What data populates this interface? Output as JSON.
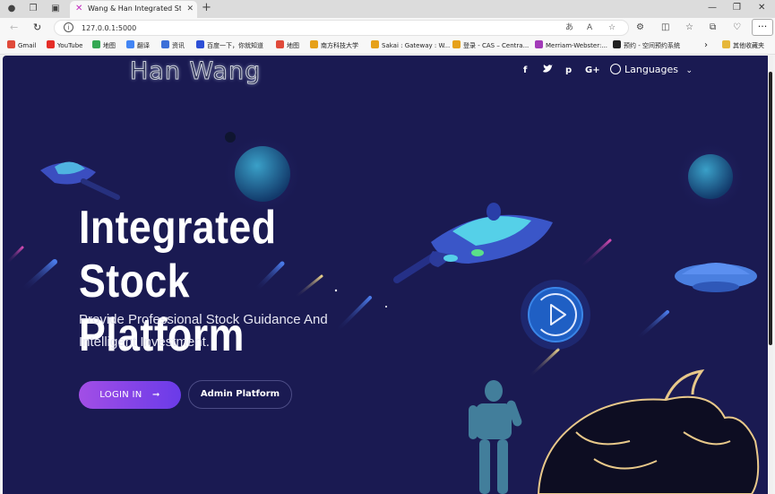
{
  "browser": {
    "tab_title": "Wang & Han Integrated Stock Pl",
    "url": "127.0.0.1:5000",
    "bookmarks": [
      {
        "label": "Gmail",
        "color": "#e04a3a"
      },
      {
        "label": "YouTube",
        "color": "#e52d27"
      },
      {
        "label": "地图",
        "color": "#34a853"
      },
      {
        "label": "翻译",
        "color": "#4285f4"
      },
      {
        "label": "资讯",
        "color": "#3b6fd8"
      },
      {
        "label": "百度一下，你就知道",
        "color": "#2d4fd6"
      },
      {
        "label": "地图",
        "color": "#e04a3a"
      },
      {
        "label": "南方科技大学",
        "color": "#e6a11a"
      },
      {
        "label": "Sakai : Gateway : W...",
        "color": "#e6a11a"
      },
      {
        "label": "登录 - CAS – Centra...",
        "color": "#e6a11a"
      },
      {
        "label": "Merriam-Webster:...",
        "color": "#a23ab8"
      },
      {
        "label": "预约 - 空间预约系统",
        "color": "#222"
      },
      {
        "label": "其他收藏夹",
        "color": "#e6b73a"
      }
    ]
  },
  "site": {
    "logo": "Han Wang",
    "social": [
      "f",
      "t",
      "p",
      "G+"
    ],
    "languages_label": "Languages",
    "hero_title_line1": "Integrated Stock",
    "hero_title_line2": "Platform",
    "hero_sub_line1": "Provide Professional Stock Guidance And",
    "hero_sub_line2": "Intelligent Investment.",
    "login_label": "LOGIN IN",
    "login_arrow": "➞",
    "admin_label": "Admin Platform"
  },
  "colors": {
    "page_bg": "#1a1a52",
    "accent_gradient_start": "#a24ee6",
    "accent_gradient_end": "#6a3be8",
    "play_blue": "#1f5fc4"
  }
}
